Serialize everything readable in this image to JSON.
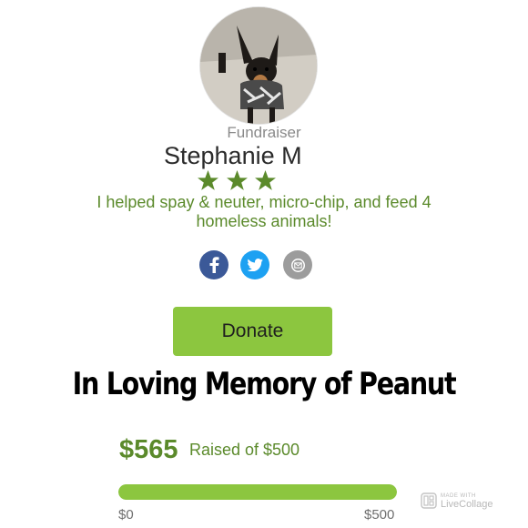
{
  "profile": {
    "role": "Fundraiser",
    "name": "Stephanie M",
    "star_count": 3,
    "achievement": "I helped spay & neuter, micro-chip, and feed 4 homeless animals!"
  },
  "share": {
    "icons": [
      "facebook-icon",
      "twitter-icon",
      "email-icon"
    ]
  },
  "actions": {
    "donate_label": "Donate"
  },
  "memorial_title": "In Loving Memory of Peanut",
  "fundraising": {
    "raised": "$565",
    "goal_text": "Raised of $500",
    "progress_percent": 100,
    "min_label": "$0",
    "max_label": "$500"
  },
  "watermark": {
    "line1": "MADE WITH",
    "line2": "LiveCollage"
  },
  "colors": {
    "accent_green": "#8cc63f",
    "text_green": "#5b8a2b",
    "facebook": "#3b5998",
    "twitter": "#1da1f2",
    "email": "#9c9c9c"
  }
}
